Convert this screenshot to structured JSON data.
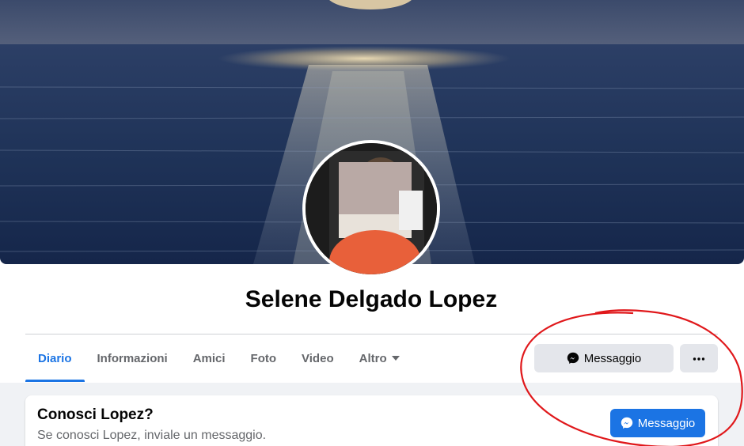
{
  "profile": {
    "name": "Selene Delgado Lopez"
  },
  "tabs": [
    {
      "label": "Diario",
      "active": true
    },
    {
      "label": "Informazioni",
      "active": false
    },
    {
      "label": "Amici",
      "active": false
    },
    {
      "label": "Foto",
      "active": false
    },
    {
      "label": "Video",
      "active": false
    },
    {
      "label": "Altro",
      "active": false,
      "has_dropdown": true
    }
  ],
  "actions": {
    "message_label": "Messaggio",
    "more_icon": "ellipsis-icon"
  },
  "know_card": {
    "title": "Conosci Lopez?",
    "subtitle": "Se conosci Lopez, inviale un messaggio.",
    "button_label": "Messaggio"
  },
  "colors": {
    "accent": "#1b74e4",
    "annotation": "#e0181b",
    "background": "#f0f2f5"
  }
}
